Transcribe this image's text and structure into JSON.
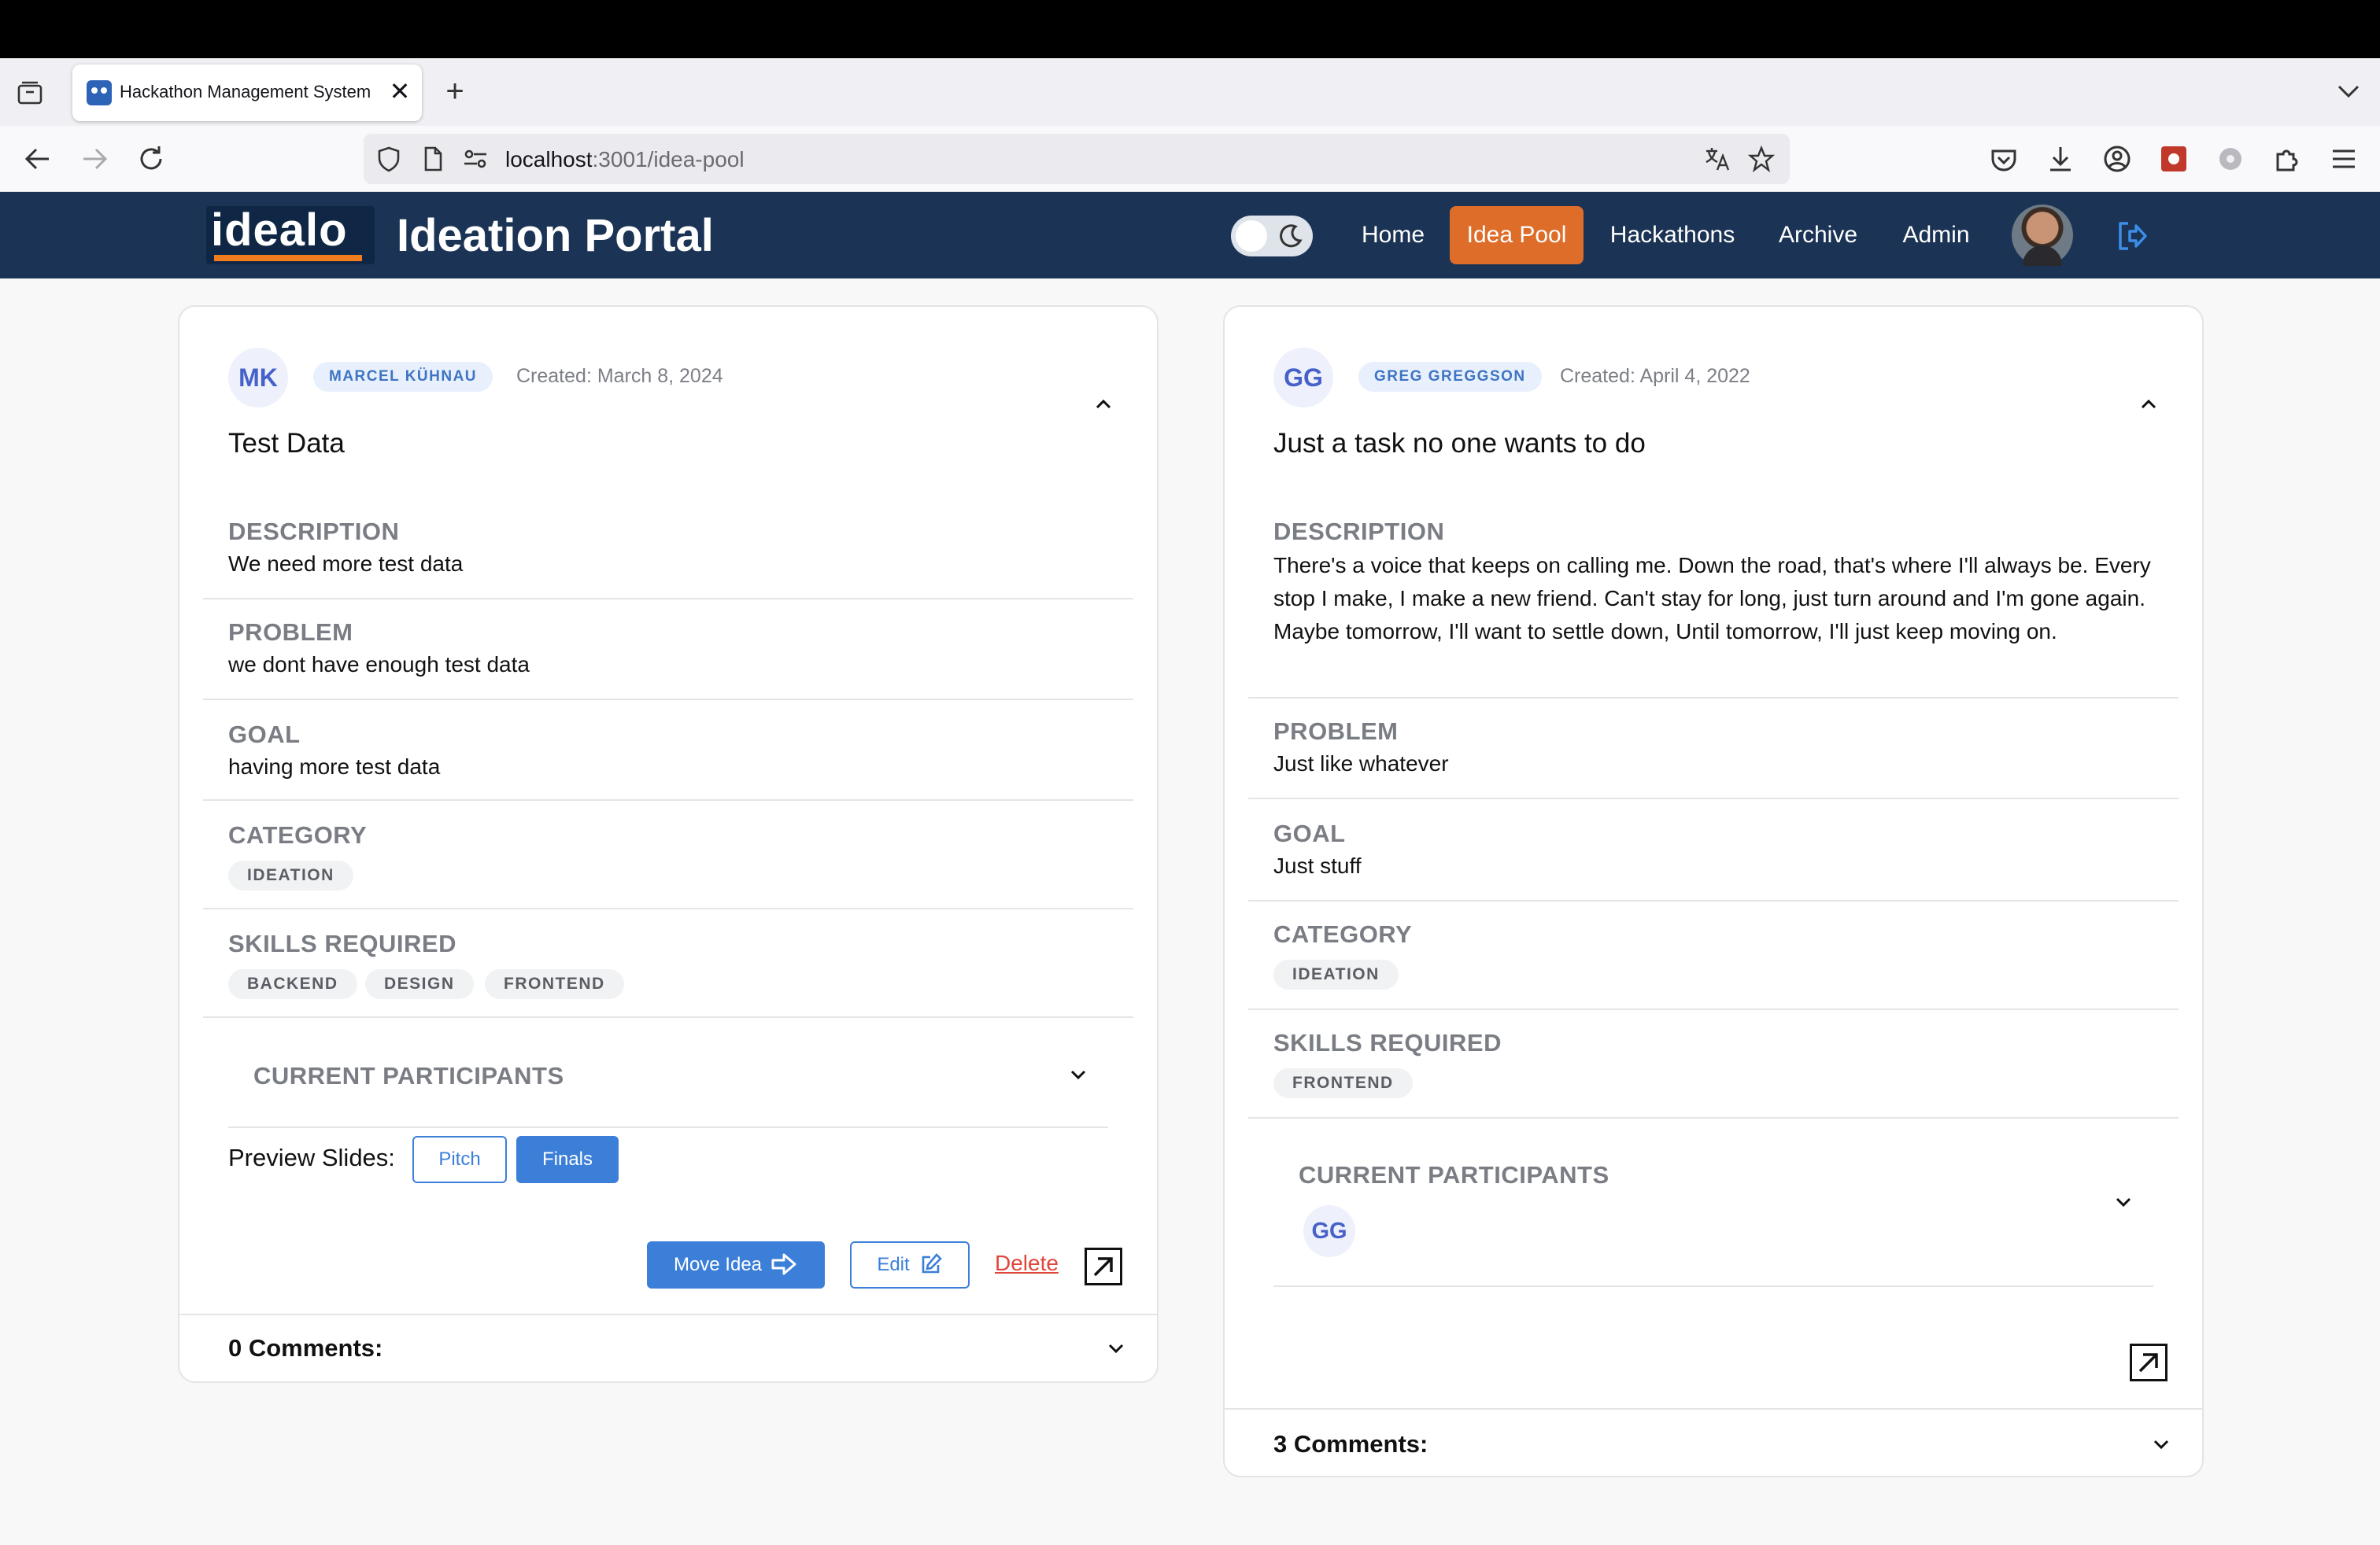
{
  "browser": {
    "tab_title": "Hackathon Management System",
    "tab_close": "✕",
    "new_tab": "+",
    "url_host": "localhost",
    "url_path": ":3001/idea-pool"
  },
  "header": {
    "logo_text": "idealo",
    "title": "Ideation Portal",
    "nav": [
      "Home",
      "Idea Pool",
      "Hackathons",
      "Archive",
      "Admin"
    ],
    "active_nav": "Idea Pool"
  },
  "ideas": [
    {
      "initials": "MK",
      "author": "MARCEL KÜHNAU",
      "created": "Created: March 8, 2024",
      "title": "Test Data",
      "description_label": "DESCRIPTION",
      "description": "We need more test data",
      "problem_label": "PROBLEM",
      "problem": "we dont have enough test data",
      "goal_label": "GOAL",
      "goal": "having more test data",
      "category_label": "CATEGORY",
      "category": "IDEATION",
      "skills_label": "SKILLS REQUIRED",
      "skills": [
        "BACKEND",
        "DESIGN",
        "FRONTEND"
      ],
      "participants_label": "CURRENT PARTICIPANTS",
      "preview_label": "Preview Slides:",
      "pitch_label": "Pitch",
      "finals_label": "Finals",
      "move_label": "Move Idea",
      "edit_label": "Edit",
      "delete_label": "Delete",
      "comments": "0 Comments:"
    },
    {
      "initials": "GG",
      "author": "GREG GREGGSON",
      "created": "Created: April 4, 2022",
      "title": "Just a task no one wants to do",
      "description_label": "DESCRIPTION",
      "description": "There's a voice that keeps on calling me. Down the road, that's where I'll always be. Every stop I make, I make a new friend. Can't stay for long, just turn around and I'm gone again. Maybe tomorrow, I'll want to settle down, Until tomorrow, I'll just keep moving on.",
      "problem_label": "PROBLEM",
      "problem": "Just like whatever",
      "goal_label": "GOAL",
      "goal": "Just stuff",
      "category_label": "CATEGORY",
      "category": "IDEATION",
      "skills_label": "SKILLS REQUIRED",
      "skills": [
        "FRONTEND"
      ],
      "participants_label": "CURRENT PARTICIPANTS",
      "participants": [
        "GG"
      ],
      "comments": "3 Comments:"
    }
  ],
  "colors": {
    "header_bg": "#1b3354",
    "active_nav": "#de6d2a",
    "primary": "#3c7fd9",
    "delete": "#e0463a"
  }
}
